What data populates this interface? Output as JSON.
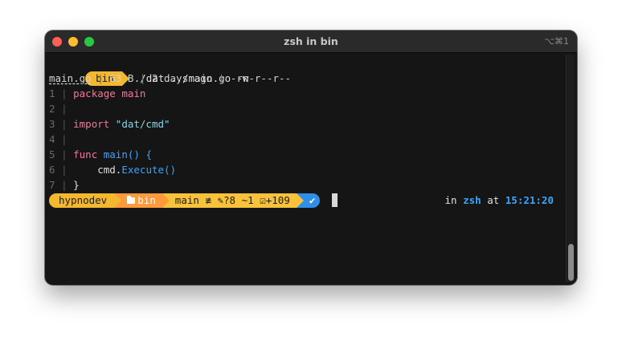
{
  "window": {
    "title": "zsh in bin",
    "shortcut": "⌥⌘1"
  },
  "command_prompt": {
    "dir": "bin",
    "command": "./dat ../main.go -n"
  },
  "file_meta": {
    "name": "main.go",
    "size": "63 B",
    "modified": "2 days ago",
    "permissions": "-rw-r--r--"
  },
  "code": {
    "separator": "|",
    "lines": [
      {
        "num": "1",
        "kw": "package",
        "rest": " main"
      },
      {
        "num": "2"
      },
      {
        "num": "3",
        "kw": "import",
        "str": " \"dat/cmd\""
      },
      {
        "num": "4"
      },
      {
        "num": "5",
        "kw": "func",
        "fn": " main() {"
      },
      {
        "num": "6",
        "plain": "    cmd.",
        "fn": "Execute()"
      },
      {
        "num": "7",
        "plain": "}"
      }
    ]
  },
  "prompt": {
    "user": "hypnodev",
    "dir": "bin",
    "branch_icon": "",
    "branch": "main",
    "branch_status": "≢",
    "untracked": "?8",
    "modified": "~1",
    "staged": "+109",
    "status_check": "✔"
  },
  "rprompt": {
    "in_word": "in",
    "shell": "zsh",
    "at_word": "at",
    "time": "15:21:20"
  },
  "colors": {
    "accent_yellow": "#f4b82e",
    "accent_orange": "#ff9a3c",
    "accent_blue": "#2f8fe6",
    "keyword_pink": "#f2779a",
    "string_cyan": "#86d3e8",
    "function_blue": "#39a4ff",
    "background": "#151515"
  }
}
